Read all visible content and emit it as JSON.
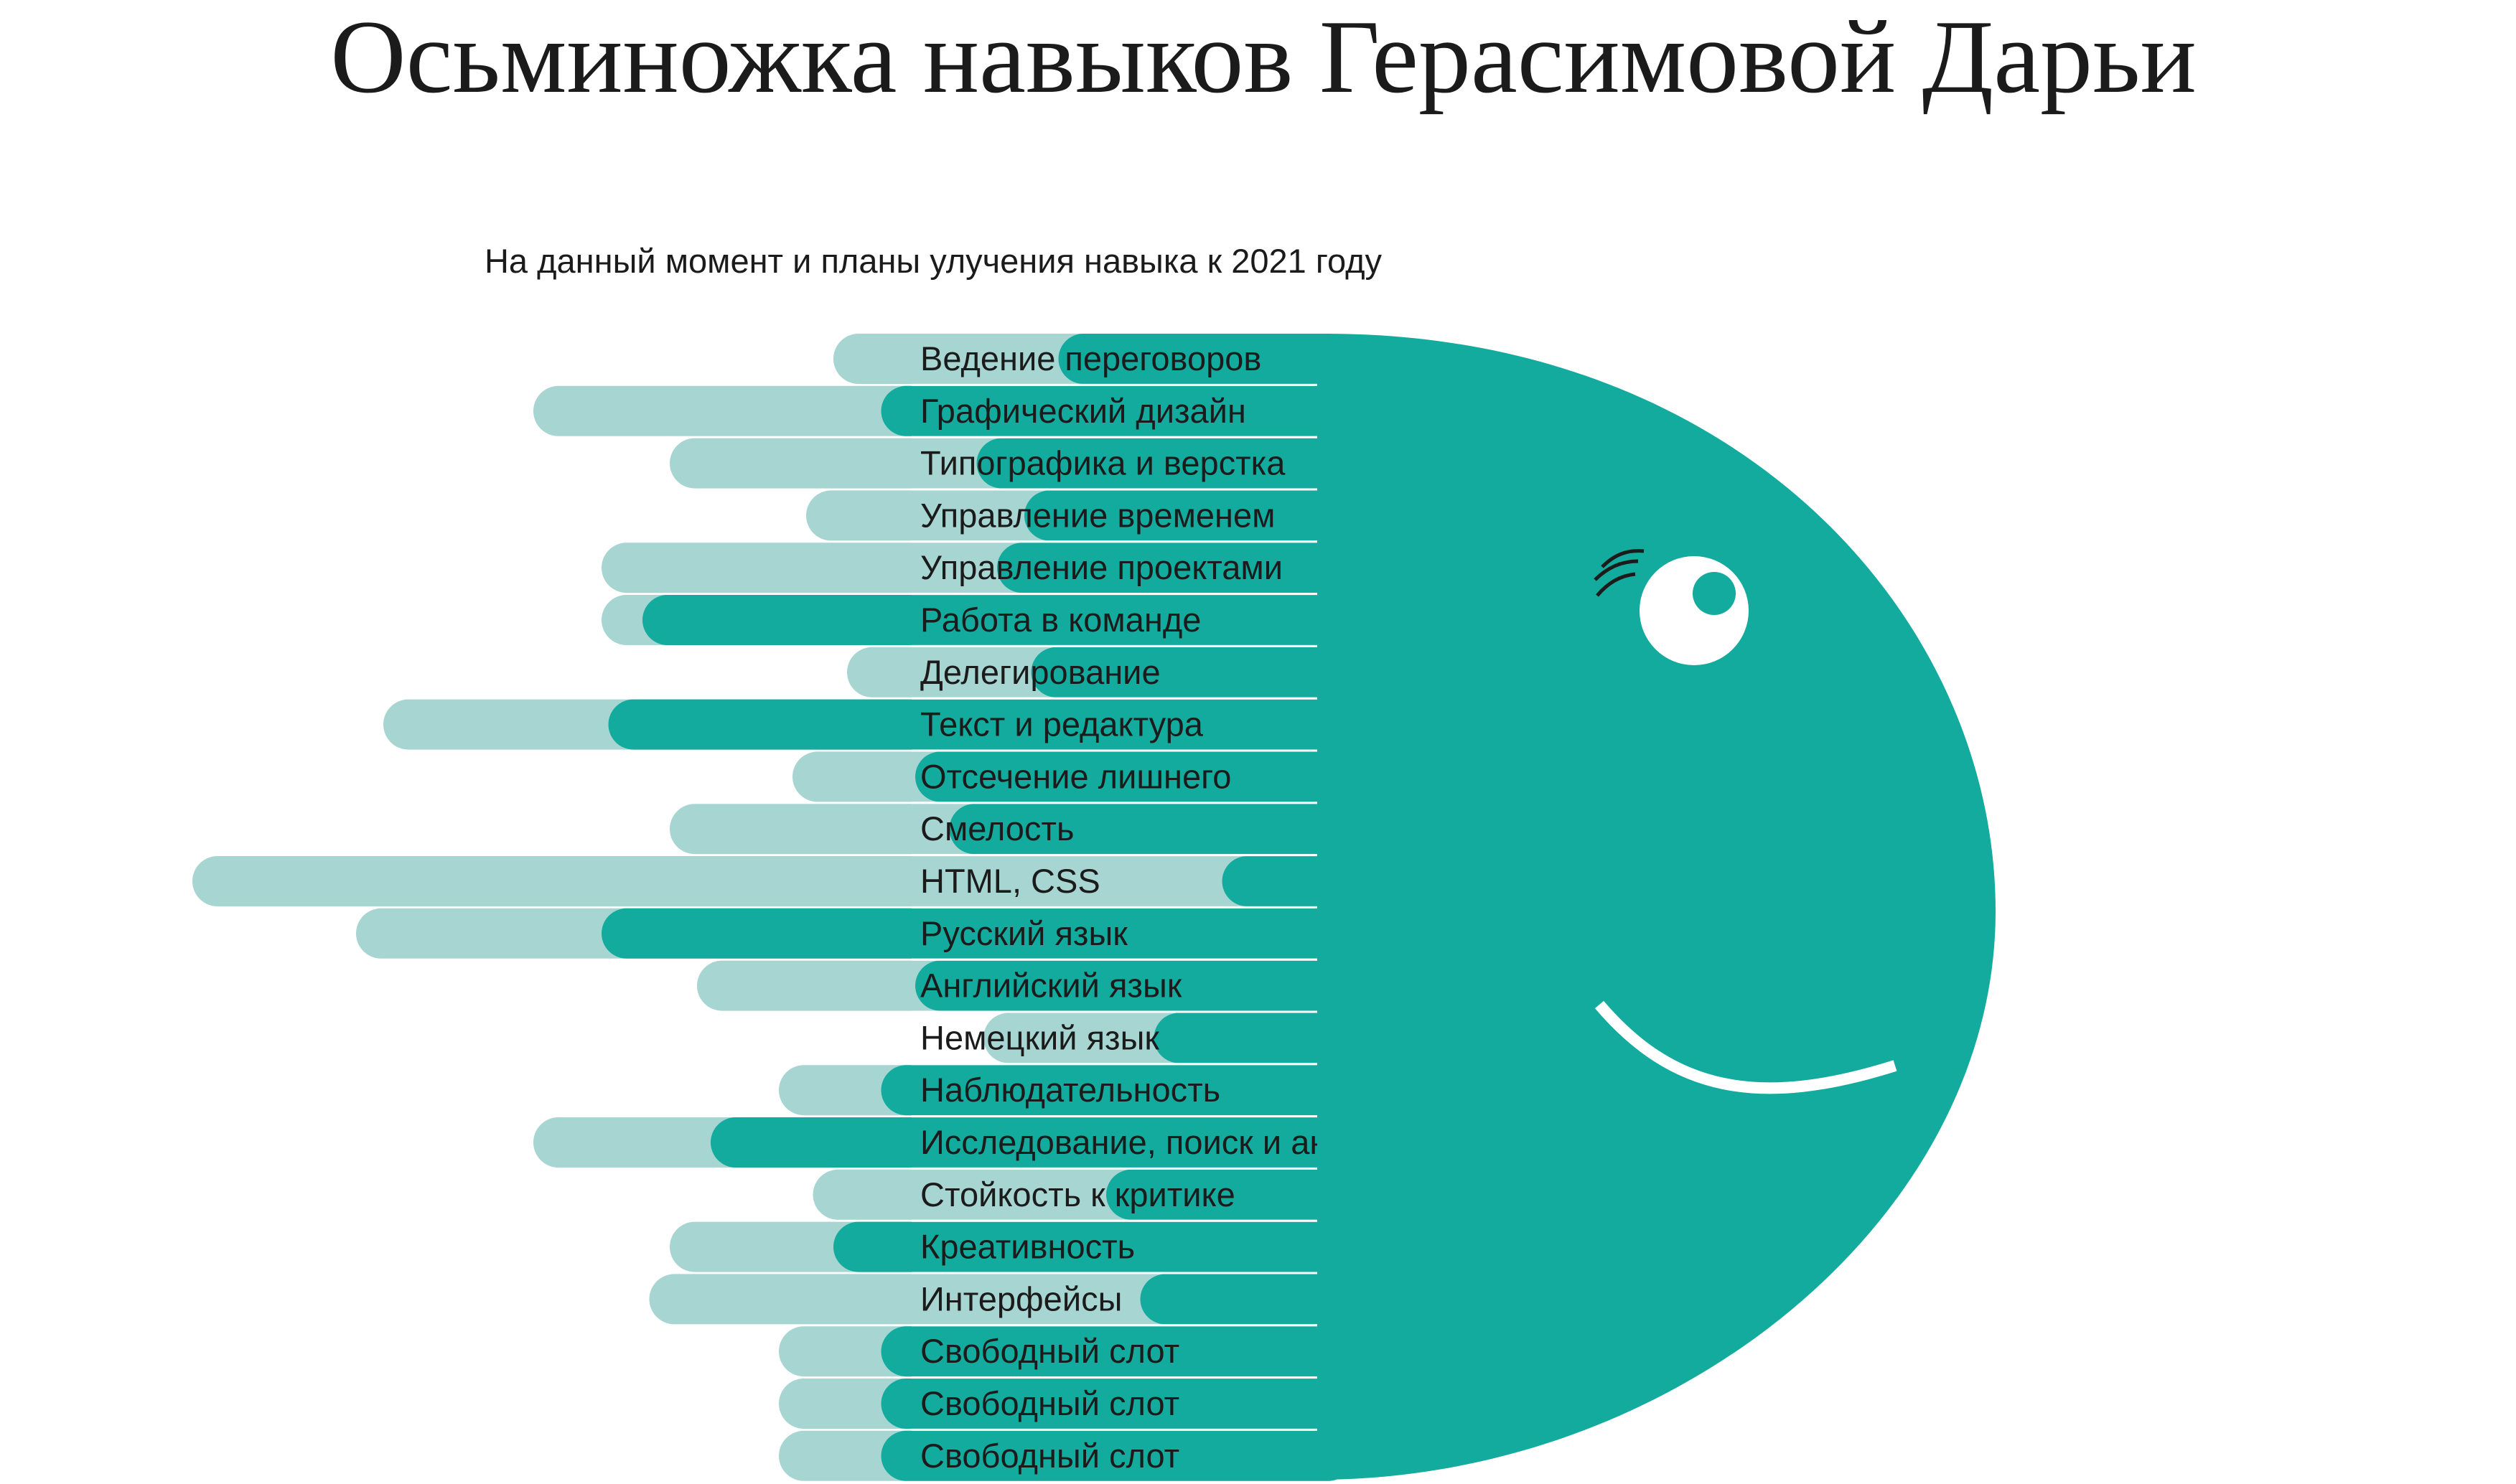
{
  "title": "Осьминожка навыков Герасимовой Дарьи",
  "subtitle": "На данный момент и планы улучения навыка к 2021 году",
  "colors": {
    "current": "#14ab9f",
    "planned": "#a7d5d2",
    "divider": "#ffffff",
    "eye_white": "#ffffff",
    "text": "#1b1b1b"
  },
  "chart_data": {
    "type": "bar",
    "orientation": "horizontal",
    "direction": "right-to-left",
    "series": [
      {
        "key": "current",
        "values": [
          3.9,
          6.5,
          5.1,
          4.4,
          4.8,
          10.0,
          4.3,
          10.5,
          6.0,
          5.5,
          1.5,
          10.6,
          6.0,
          2.5,
          6.5,
          9.0,
          3.2,
          7.2,
          2.7,
          6.5,
          6.5,
          6.5
        ]
      },
      {
        "key": "planned",
        "values": [
          7.2,
          11.6,
          9.6,
          7.6,
          10.6,
          10.6,
          7.0,
          13.8,
          7.8,
          9.6,
          16.6,
          14.2,
          9.2,
          5.0,
          8.0,
          11.6,
          7.5,
          9.6,
          9.9,
          8.0,
          8.0,
          8.0
        ]
      }
    ],
    "categories": [
      "Ведение переговоров",
      "Графический дизайн",
      "Типографика и верстка",
      "Управление временем",
      "Управление проектами",
      "Работа в команде",
      "Делегирование",
      "Текст и редактура",
      "Отсечение лишнего",
      "Смелость",
      "HTML, CSS",
      "Русский язык",
      "Английский язык",
      "Немецкий язык",
      "Наблюдательность",
      "Исследование, поиск и анализ",
      "Стойкость к критике",
      "Креативность",
      "Интерфейсы",
      "Свободный слот",
      "Свободный слот",
      "Свободный слот"
    ],
    "title": "Осьминожка навыков Герасимовой Дарьи",
    "subtitle": "На данный момент и планы улучения навыка к 2021 году",
    "xlim": [
      0,
      18
    ],
    "grid": false,
    "legend": "none"
  }
}
